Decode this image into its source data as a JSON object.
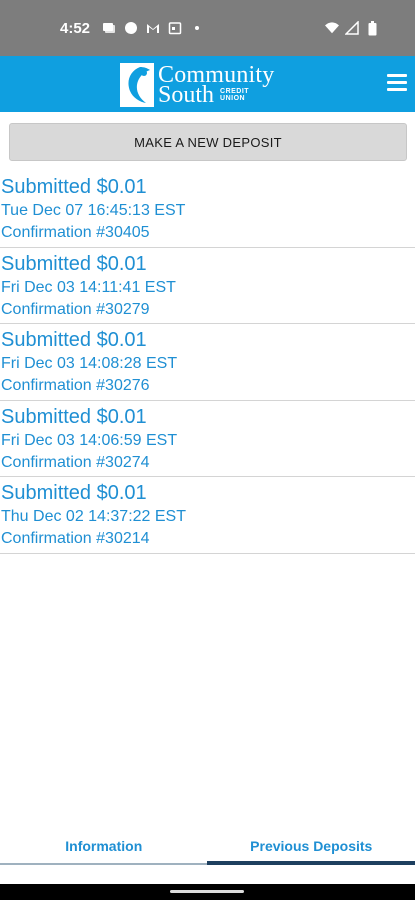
{
  "status_bar": {
    "time": "4:52",
    "icons_left": [
      "message-icon",
      "chat-icon",
      "gmail-icon",
      "calendar-icon",
      "dot-icon"
    ],
    "icons_right": [
      "wifi-icon",
      "signal-icon",
      "battery-icon"
    ]
  },
  "header": {
    "logo_line1": "Community",
    "logo_line2": "South",
    "logo_cu_line1": "CREDIT",
    "logo_cu_line2": "UNION",
    "brand_color": "#0f9fe0"
  },
  "actions": {
    "make_deposit_label": "MAKE A NEW DEPOSIT"
  },
  "deposits": [
    {
      "title": "Submitted $0.01",
      "date": "Tue Dec 07 16:45:13 EST",
      "confirmation": "Confirmation #30405"
    },
    {
      "title": "Submitted $0.01",
      "date": "Fri Dec 03 14:11:41 EST",
      "confirmation": "Confirmation #30279"
    },
    {
      "title": "Submitted $0.01",
      "date": "Fri Dec 03 14:08:28 EST",
      "confirmation": "Confirmation #30276"
    },
    {
      "title": "Submitted $0.01",
      "date": "Fri Dec 03 14:06:59 EST",
      "confirmation": "Confirmation #30274"
    },
    {
      "title": "Submitted $0.01",
      "date": "Thu Dec 02 14:37:22 EST",
      "confirmation": "Confirmation #30214"
    }
  ],
  "tabs": {
    "information": "Information",
    "previous_deposits": "Previous Deposits",
    "active": "previous_deposits"
  },
  "colors": {
    "link_blue": "#1f8fd3",
    "tab_active_underline": "#1d3f5f"
  }
}
